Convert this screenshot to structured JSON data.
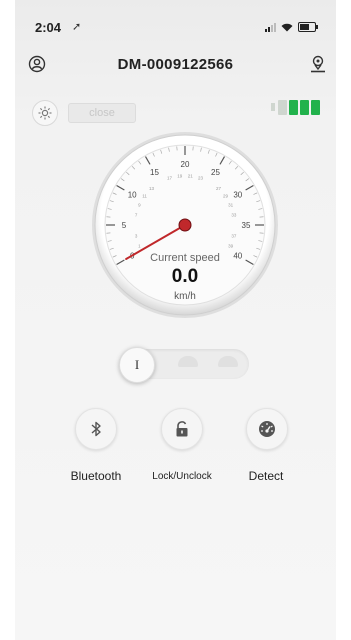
{
  "status_bar": {
    "time": "2:04",
    "location_glyph": "➚"
  },
  "header": {
    "title": "DM-0009122566",
    "left_icon": "profile-icon",
    "right_icon": "location-pin-icon"
  },
  "controls": {
    "light_icon": "sun-icon",
    "close_label": "close"
  },
  "battery": {
    "level_segments": 3,
    "total_segments": 4,
    "fill_color": "#22b24c",
    "empty_color": "#cfd6cf"
  },
  "speedometer": {
    "label": "Current speed",
    "value": "0.0",
    "unit": "km/h",
    "major_ticks": [
      "0",
      "5",
      "10",
      "15",
      "20",
      "25",
      "30",
      "35",
      "40"
    ],
    "minor_ticks": [
      "1",
      "3",
      "7",
      "9",
      "11",
      "13",
      "17",
      "19",
      "21",
      "23",
      "27",
      "29",
      "31",
      "33",
      "37",
      "39"
    ],
    "needle_color": "#c0282b"
  },
  "gear_selector": {
    "selected": "I",
    "positions": 3
  },
  "actions": [
    {
      "label": "Bluetooth",
      "icon": "bluetooth-icon"
    },
    {
      "label": "Lock/Unclock",
      "icon": "lock-icon"
    },
    {
      "label": "Detect",
      "icon": "speedometer-icon"
    }
  ]
}
